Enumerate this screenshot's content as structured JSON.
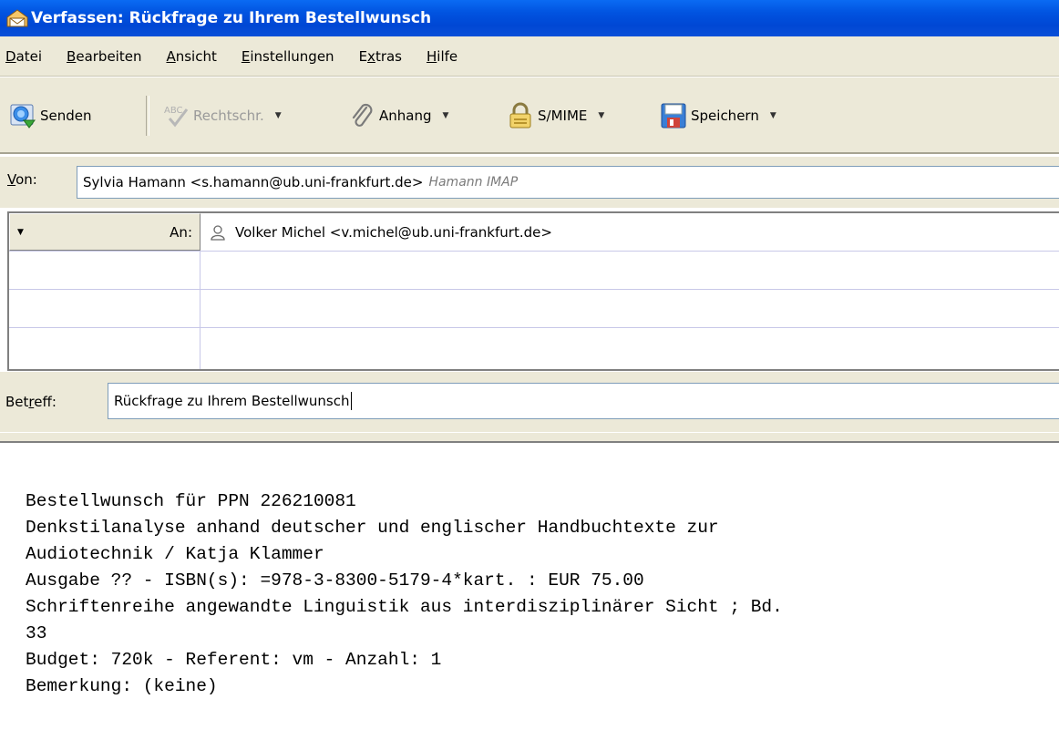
{
  "window": {
    "title": "Verfassen: Rückfrage zu Ihrem Bestellwunsch",
    "icon": "compose-icon"
  },
  "menu": [
    {
      "pre": "",
      "key": "D",
      "post": "atei"
    },
    {
      "pre": "",
      "key": "B",
      "post": "earbeiten"
    },
    {
      "pre": "",
      "key": "A",
      "post": "nsicht"
    },
    {
      "pre": "",
      "key": "E",
      "post": "instellungen"
    },
    {
      "pre": "E",
      "key": "x",
      "post": "tras"
    },
    {
      "pre": "",
      "key": "H",
      "post": "ilfe"
    }
  ],
  "toolbar": {
    "send": "Senden",
    "spell": "Rechtschr.",
    "attach": "Anhang",
    "smime": "S/MIME",
    "save": "Speichern"
  },
  "header": {
    "from_label_key": "V",
    "from_label_rest": "on:",
    "from_value": "Sylvia Hamann <s.hamann@ub.uni-frankfurt.de>",
    "from_account": "Hamann IMAP",
    "to_type": "An:",
    "to_value": "Volker Michel <v.michel@ub.uni-frankfurt.de>",
    "subject_label_pre": "Bet",
    "subject_label_key": "r",
    "subject_label_post": "eff:",
    "subject_value": "Rückfrage zu Ihrem Bestellwunsch"
  },
  "body": {
    "lines": [
      "Bestellwunsch für PPN 226210081",
      "Denkstilanalyse anhand deutscher und englischer Handbuchtexte zur",
      "Audiotechnik / Katja Klammer",
      "Ausgabe ?? - ISBN(s): =978-3-8300-5179-4*kart. : EUR 75.00",
      "Schriftenreihe angewandte Linguistik aus interdisziplinärer Sicht ; Bd.",
      "33",
      "Budget: 720k - Referent: vm - Anzahl: 1",
      "Bemerkung: (keine)"
    ]
  },
  "colors": {
    "titlebar": "#0153e0",
    "chrome": "#ece9d8",
    "field_border": "#7f9db9"
  }
}
